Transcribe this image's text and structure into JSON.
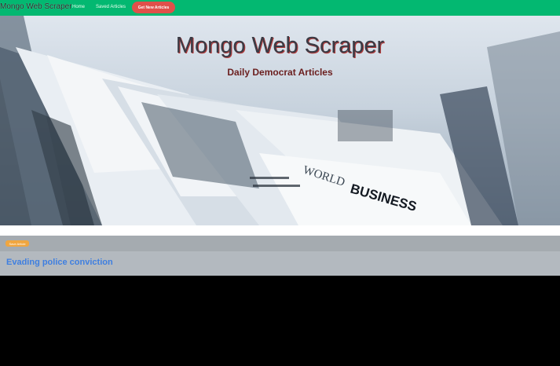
{
  "navbar": {
    "brand": "Mongo Web Scraper",
    "links": [
      "Home",
      "Saved Articles"
    ],
    "scrape_button": "Get New Articles",
    "color": "#03b871"
  },
  "hero": {
    "title": "Mongo Web Scraper",
    "subtitle": "Daily Democrat Articles",
    "background_text": [
      "WORLD",
      "BUSINESS"
    ]
  },
  "articles": [
    {
      "save_label": "Save Article",
      "title": "Evading police conviction"
    }
  ],
  "colors": {
    "save_button": "#f0a640",
    "article_title": "#3f7fe0",
    "scrape_button": "#e0504a"
  }
}
